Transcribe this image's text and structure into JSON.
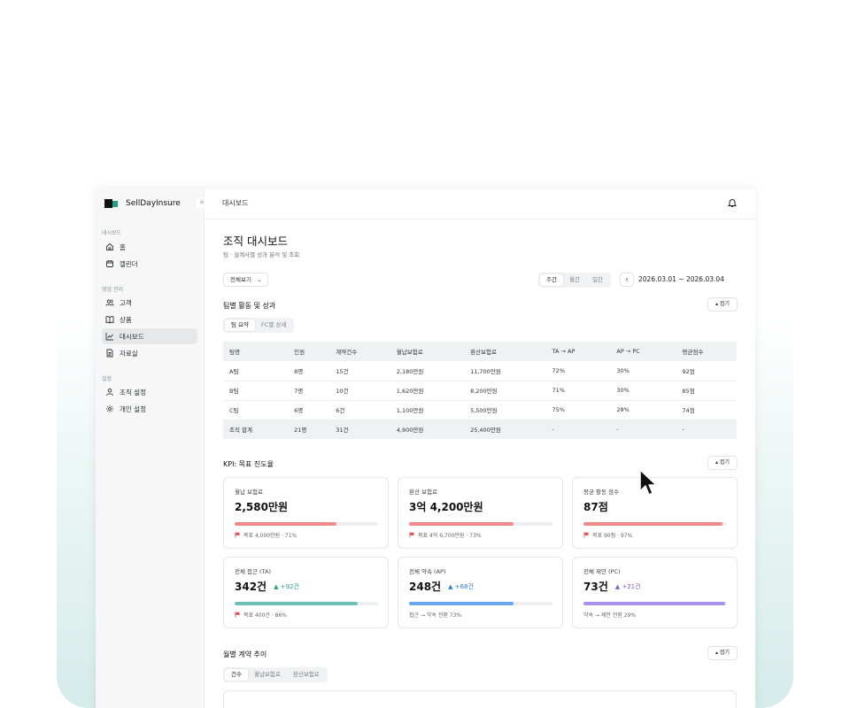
{
  "brand": {
    "name": "SellDayInsure",
    "collapse_icon": "double-chevron-left-icon"
  },
  "sidebar": {
    "sections": [
      {
        "label": "대시보드",
        "items": [
          {
            "label": "홈",
            "icon": "home-icon"
          },
          {
            "label": "캘린더",
            "icon": "calendar-icon"
          }
        ]
      },
      {
        "label": "영업 관리",
        "items": [
          {
            "label": "고객",
            "icon": "users-icon"
          },
          {
            "label": "상품",
            "icon": "book-icon"
          },
          {
            "label": "대시보드",
            "icon": "chart-line-icon",
            "active": true
          },
          {
            "label": "자료실",
            "icon": "document-icon"
          }
        ]
      },
      {
        "label": "설정",
        "items": [
          {
            "label": "조직 설정",
            "icon": "user-icon"
          },
          {
            "label": "개인 설정",
            "icon": "gear-icon"
          }
        ]
      }
    ]
  },
  "header": {
    "breadcrumb": "대시보드",
    "bell_icon": "bell-icon"
  },
  "page": {
    "title": "조직 대시보드",
    "subtitle": "팀 · 설계사별 성과 분석 및 조회"
  },
  "filters": {
    "view_select": "전체보기",
    "period_options": [
      "주간",
      "월간",
      "일간"
    ],
    "period_selected": "주간",
    "date_range": "2026.03.01 ~ 2026.03.04",
    "prev": "‹",
    "next": "›"
  },
  "team_section": {
    "title": "팀별 활동 및 성과",
    "fold_label": "접기",
    "tabs": [
      "팀 요약",
      "FC별 상세"
    ],
    "table": {
      "headers": [
        "팀명",
        "인원",
        "계약건수",
        "월납보험료",
        "환산보험료",
        "TA → AP",
        "AP → PC",
        "평균점수"
      ],
      "rows": [
        [
          "A팀",
          "8명",
          "15건",
          "2,180만원",
          "11,700만원",
          "72%",
          "30%",
          "92점"
        ],
        [
          "B팀",
          "7명",
          "10건",
          "1,620만원",
          "8,200만원",
          "71%",
          "30%",
          "85점"
        ],
        [
          "C팀",
          "6명",
          "6건",
          "1,100만원",
          "5,500만원",
          "75%",
          "28%",
          "74점"
        ]
      ],
      "total": [
        "조직 합계",
        "21명",
        "31건",
        "4,900만원",
        "25,400만원",
        "-",
        "-",
        "-"
      ]
    }
  },
  "kpi_section": {
    "title": "KPI: 목표 진도율",
    "fold_label": "접기",
    "cards": [
      {
        "label": "월납 보험료",
        "value": "2,580만원",
        "delta": "",
        "progress": 0.71,
        "color": "#f08a8a",
        "footer": "목표 4,000만원 · 71%",
        "flag": true
      },
      {
        "label": "환산 보험료",
        "value": "3억 4,200만원",
        "delta": "",
        "progress": 0.73,
        "color": "#f08a8a",
        "footer": "목표 4억 6,700만원 · 73%",
        "flag": true
      },
      {
        "label": "평균 활동 점수",
        "value": "87점",
        "delta": "",
        "progress": 0.97,
        "color": "#f08a8a",
        "footer": "목표 90점 · 97%",
        "flag": true
      },
      {
        "label": "전체 접근 (TA)",
        "value": "342건",
        "delta": "▲ +92건",
        "delta_color": "#2a9d8f",
        "progress": 0.86,
        "color": "#6cc3b4",
        "footer": "목표 400건 · 86%",
        "flag": true
      },
      {
        "label": "전체 약속 (AP)",
        "value": "248건",
        "delta": "▲ +68건",
        "delta_color": "#2f7fdc",
        "progress": 0.73,
        "color": "#6aa6f0",
        "footer": "접근 → 약속 전환 73%",
        "flag": false
      },
      {
        "label": "전체 제안 (PC)",
        "value": "73건",
        "delta": "▲ +21건",
        "delta_color": "#7b5fd4",
        "progress": 0.99,
        "color": "#a892ee",
        "footer": "약속 → 제안 전환 29%",
        "flag": false
      }
    ]
  },
  "monthly_section": {
    "title": "월별 계약 추이",
    "fold_label": "접기",
    "tabs": [
      "건수",
      "월납보험료",
      "환산보험료"
    ]
  }
}
